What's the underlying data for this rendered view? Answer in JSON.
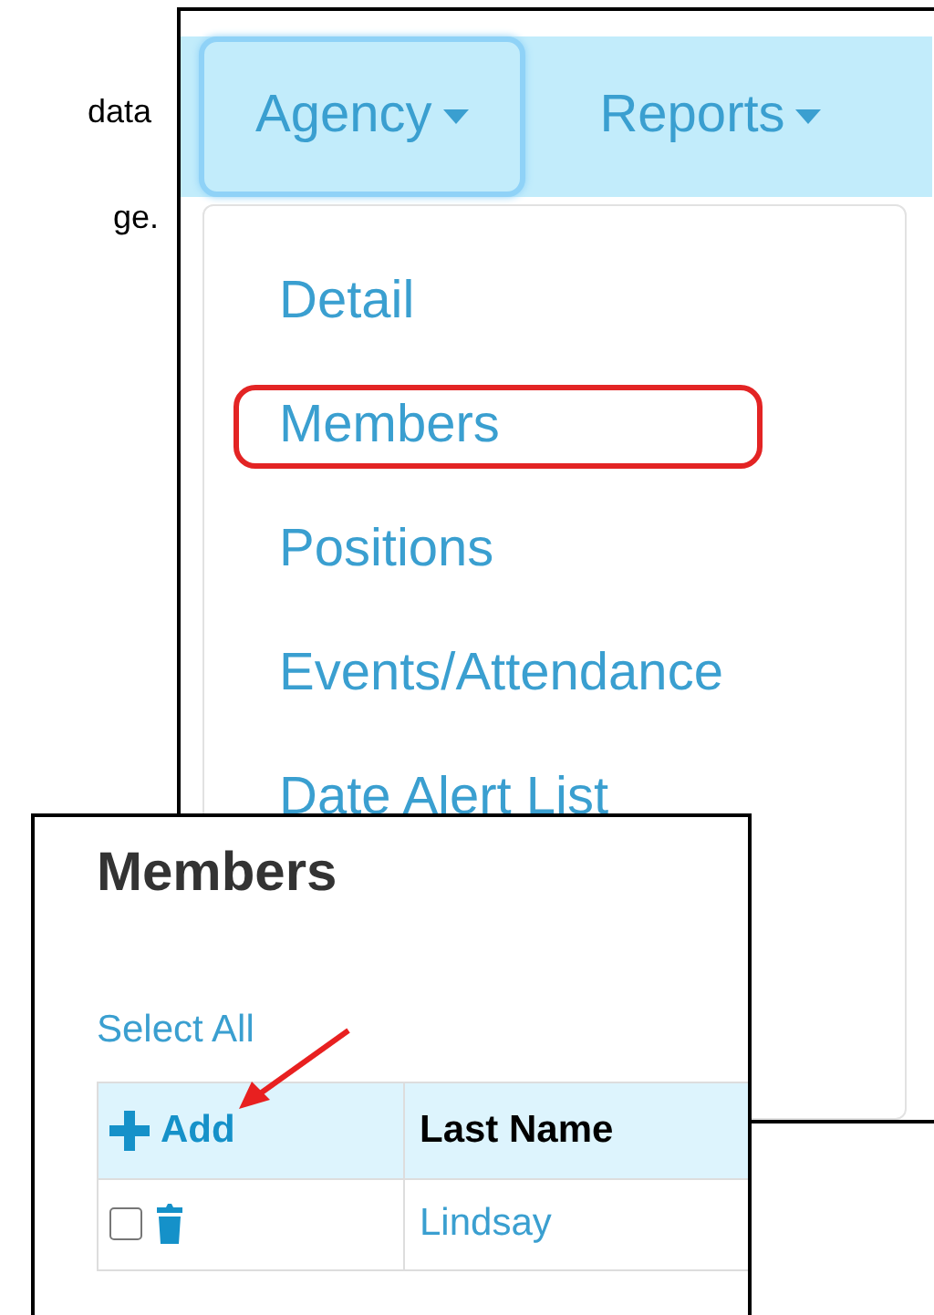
{
  "document_fragments": [
    "data",
    "ge."
  ],
  "agency_screen": {
    "nav": [
      {
        "label": "Agency",
        "selected": true
      },
      {
        "label": "Reports",
        "selected": false
      }
    ],
    "menu": [
      {
        "label": "Detail",
        "highlighted": false
      },
      {
        "label": "Members",
        "highlighted": true
      },
      {
        "label": "Positions",
        "highlighted": false
      },
      {
        "label": "Events/Attendance",
        "highlighted": false
      },
      {
        "label": "Date Alert List",
        "highlighted": false
      }
    ]
  },
  "members_screen": {
    "title": "Members",
    "select_all": "Select All",
    "add": "Add",
    "columns": [
      "Last Name"
    ],
    "rows": [
      {
        "checked": false,
        "last_name": "Lindsay"
      }
    ]
  }
}
